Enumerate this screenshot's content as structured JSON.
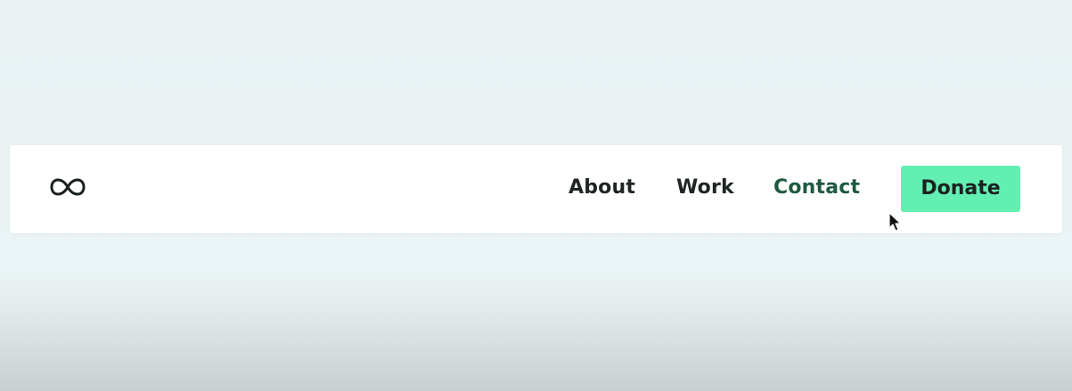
{
  "nav": {
    "logo_icon": "infinity-icon",
    "links": [
      {
        "label": "About"
      },
      {
        "label": "Work"
      },
      {
        "label": "Contact"
      }
    ],
    "donate_label": "Donate"
  },
  "colors": {
    "nav_text": "#1f2424",
    "contact_text": "#1e5a40",
    "donate_bg": "#63efb2"
  },
  "cursor_icon": "mouse-pointer-icon"
}
